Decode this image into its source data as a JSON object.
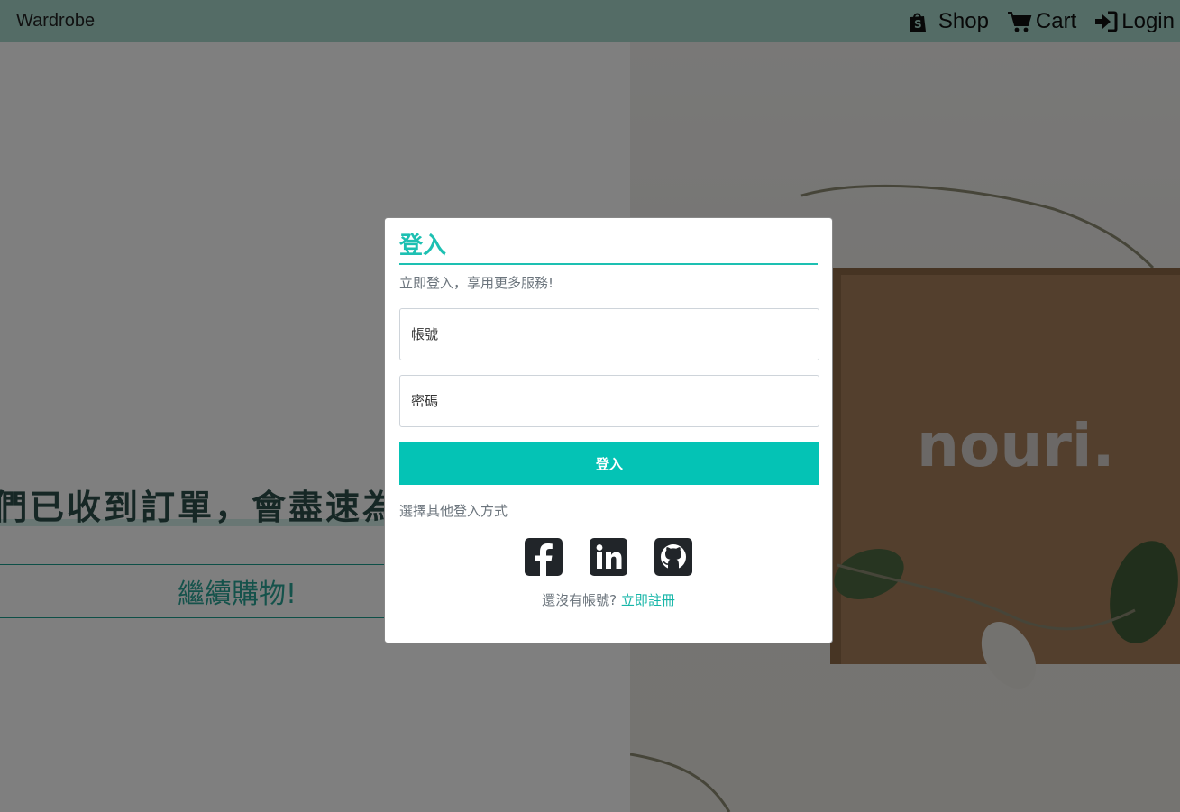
{
  "navbar": {
    "brand": "Wardrobe",
    "links": [
      {
        "label": "Shop",
        "icon": "shopify-bag-icon"
      },
      {
        "label": "Cart",
        "icon": "cart-icon"
      },
      {
        "label": "Login",
        "icon": "sign-in-icon"
      }
    ]
  },
  "page": {
    "order_message": "們已收到訂單，會盡速為",
    "continue_label": "繼續購物!",
    "photo_text": "nouri."
  },
  "modal": {
    "title": "登入",
    "subtitle": "立即登入，享用更多服務!",
    "account_placeholder": "帳號",
    "password_placeholder": "密碼",
    "login_button": "登入",
    "other_methods": "選擇其他登入方式",
    "socials": [
      "facebook-icon",
      "linkedin-icon",
      "github-icon"
    ],
    "no_account_text": "還沒有帳號? ",
    "register_link": "立即註冊"
  },
  "colors": {
    "accent": "#04c3b5",
    "navbar": "#a8d9cd"
  }
}
